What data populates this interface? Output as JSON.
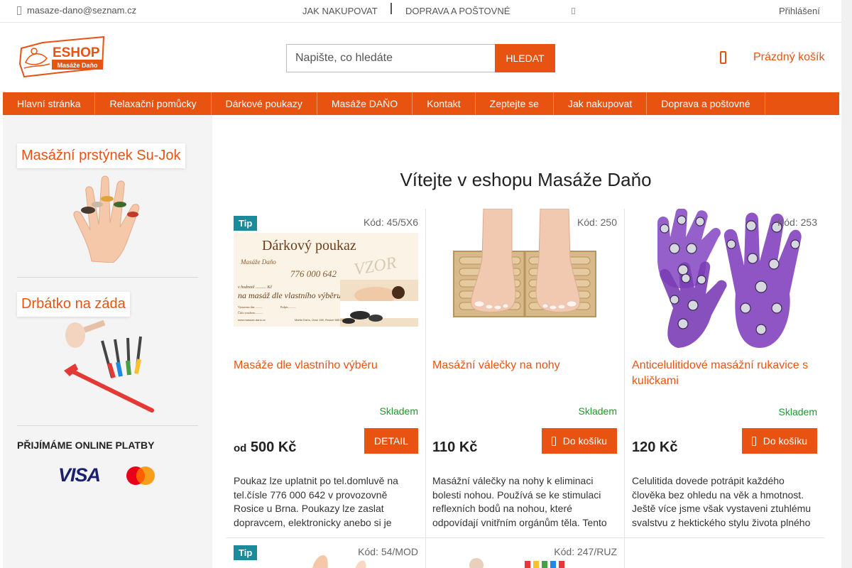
{
  "topbar": {
    "email": "masaze-dano@seznam.cz",
    "nav": [
      "JAK NAKUPOVAT",
      "DOPRAVA A POŠTOVNÉ"
    ],
    "login": "Přihlášení"
  },
  "logo": {
    "main": "ESHOP",
    "sub": "Masáže Daňo"
  },
  "search": {
    "placeholder": "Napište, co hledáte",
    "button": "HLEDAT"
  },
  "cart": {
    "label": "Prázdný košík"
  },
  "menu": [
    "Hlavní stránka",
    "Relaxační pomůcky",
    "Dárkové poukazy",
    "Masáže DAŇO",
    "Kontakt",
    "Zeptejte se",
    "Jak nakupovat",
    "Doprava a poštovné"
  ],
  "sidebar": {
    "widgets": [
      {
        "title": "Masážní prstýnek Su-Jok"
      },
      {
        "title": "Drbátko na záda"
      }
    ],
    "payments": {
      "title": "PŘIJÍMÁME ONLINE PLATBY",
      "visa": "VISA"
    }
  },
  "main": {
    "heading": "Vítejte v eshopu Masáže Daňo",
    "products": [
      {
        "tip": "Tip",
        "code": "Kód: 45/5X6",
        "name": "Masáže dle vlastního výběru",
        "stock": "Skladem",
        "price_prefix": "od",
        "price": "500 Kč",
        "button": "DETAIL",
        "description": "Poukaz lze uplatnit po tel.domluvě na tel.čísle 776 000 642 v provozovně Rosice u Brna. Poukazy lze zaslat dopravcem, elektronicky anebo si je",
        "voucher": {
          "title": "Dárkový poukaz",
          "brand": "Masáže Daňo",
          "phone": "776 000 642",
          "watermark": "VZOR",
          "value_line": "v hodnotě .......... Kč",
          "purpose": "na masáž dle vlastního výběru",
          "field1": "Vystaveno dne ..........",
          "field2": "Číslo voucheru ..........",
          "field3": "Podpis ..........",
          "footer_web": "www.masaze-dano.cz",
          "footer_addr": "Martin Daňo, Úvoz 169, Rosice 665 01"
        }
      },
      {
        "tip": "",
        "code": "Kód: 250",
        "name": "Masážní válečky na nohy",
        "stock": "Skladem",
        "price_prefix": "",
        "price": "110 Kč",
        "button": "Do košíku",
        "description": "Masážní válečky na nohy k eliminaci bolesti nohou. Používá se ke stimulaci reflexních bodů na nohou, které odpovídají vnitřním orgánům těla. Tento"
      },
      {
        "tip": "",
        "code": "Kód: 253",
        "name": "Anticelulitidové masážní rukavice s kuličkami",
        "stock": "Skladem",
        "price_prefix": "",
        "price": "120 Kč",
        "button": "Do košíku",
        "description": "Celulitida dovede potrápit každého člověka bez ohledu na věk a hmotnost. Ještě více jsme však vystaveni ztuhlému svalstvu z hektického stylu života plného"
      },
      {
        "tip": "Tip",
        "code": "Kód: 54/MOD"
      },
      {
        "tip": "",
        "code": "Kód: 247/RUZ"
      }
    ]
  },
  "colors": {
    "accent": "#e95312",
    "tip": "#1b8a9a",
    "stock": "#1a9b2a",
    "sidebar_bg": "#f4f4f4"
  },
  "icons": [
    "phone-icon",
    "info-icon",
    "cart-icon",
    "cart-button-icon",
    "visa-logo",
    "mastercard-logo"
  ]
}
